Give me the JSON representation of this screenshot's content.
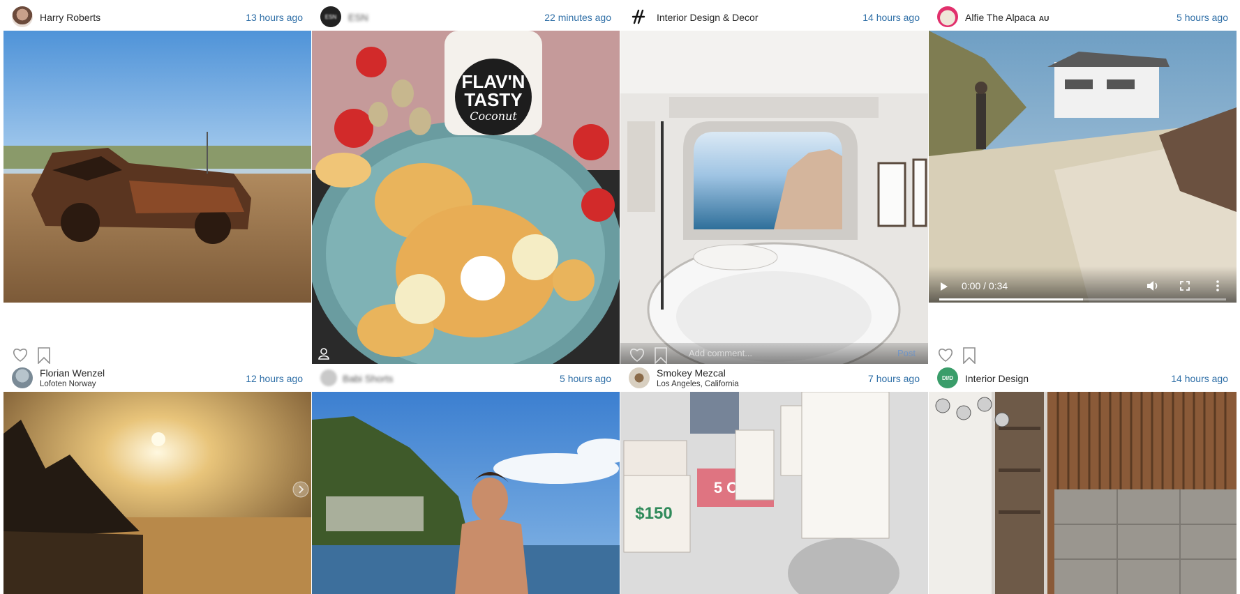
{
  "posts": [
    {
      "user": "Harry Roberts",
      "time": "13 hours ago"
    },
    {
      "user": "ESN",
      "time": "22 minutes ago",
      "avatar_text": "ESN"
    },
    {
      "user": "Interior Design & Decor",
      "time": "14 hours ago"
    },
    {
      "user": "Alfie The Alpaca",
      "badge": "AU",
      "time": "5 hours ago",
      "video": {
        "time": "0:00 / 0:34",
        "progress": 0.5
      }
    },
    {
      "user": "Florian Wenzel",
      "location": "Lofoten Norway",
      "time": "12 hours ago"
    },
    {
      "user": "Babi Shorts",
      "time": "5 hours ago"
    },
    {
      "user": "Smokey Mezcal",
      "location": "Los Angeles, California",
      "time": "7 hours ago"
    },
    {
      "user": "Interior Design",
      "time": "14 hours ago",
      "avatar_text": "DI/D"
    }
  ],
  "comment": {
    "placeholder": "Add comment...",
    "post_label": "Post"
  },
  "overlay": {
    "flav_line1": "FLAV'N",
    "flav_line2": "TASTY",
    "flav_line3": "Coconut",
    "note_price": "$150",
    "note_off": "5 OFF"
  },
  "icons": [
    "heart-icon",
    "bookmark-icon",
    "user-tag-icon",
    "play-icon",
    "volume-icon",
    "fullscreen-icon",
    "more-vert-icon",
    "chevron-right-icon"
  ],
  "colors": {
    "time_link": "#2f6fa7",
    "avatar_ring": "#e1306c",
    "design_green": "#3a9d6a"
  }
}
